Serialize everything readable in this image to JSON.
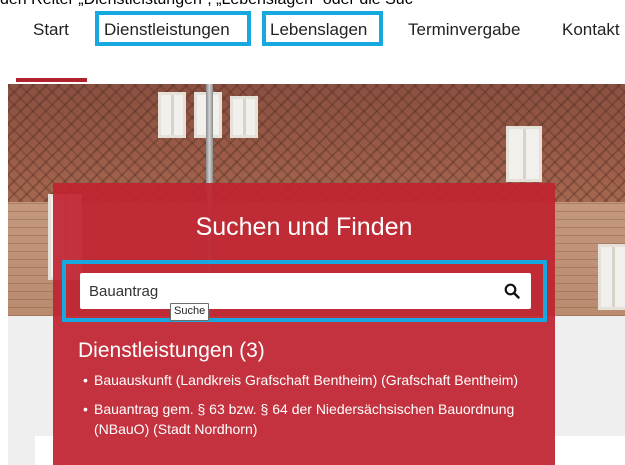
{
  "caption_text": "den Reiter „Dienstleistungen“, „Lebenslagen“ oder die Suc",
  "nav": {
    "items": [
      {
        "label": "Start"
      },
      {
        "label": "Dienstleistungen"
      },
      {
        "label": "Lebenslagen"
      },
      {
        "label": "Terminvergabe"
      },
      {
        "label": "Kontakt"
      }
    ]
  },
  "colors": {
    "accent": "#bf2330",
    "highlight": "#18a8e0"
  },
  "search": {
    "title": "Suchen und Finden",
    "value": "Bauantrag",
    "button_icon": "search-icon",
    "tooltip": "Suche"
  },
  "results": {
    "heading": "Dienstleistungen (3)",
    "items": [
      {
        "label": "Bauauskunft (Landkreis Grafschaft Bentheim) (Grafschaft Bentheim)"
      },
      {
        "label": "Bauantrag gem. § 63 bzw. § 64 der Niedersächsischen Bauordnung (NBauO) (Stadt Nordhorn)"
      }
    ]
  }
}
